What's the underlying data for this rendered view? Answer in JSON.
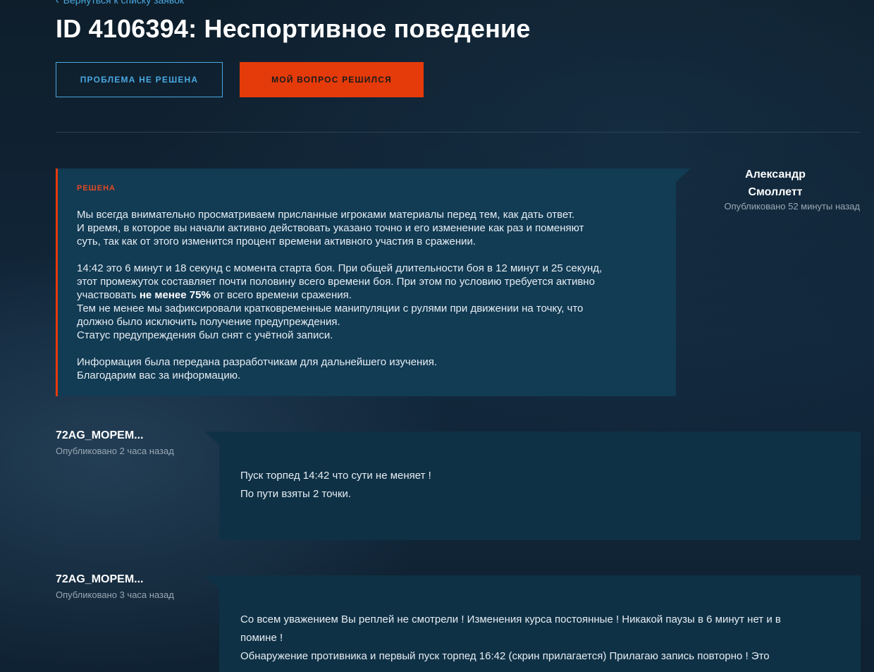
{
  "nav": {
    "back_label": "Вернуться к списку заявок"
  },
  "ticket": {
    "title": "ID 4106394: Неспортивное поведение"
  },
  "actions": {
    "not_resolved_label": "ПРОБЛЕМА НЕ РЕШЕНА",
    "resolved_label": "МОЙ ВОПРОС РЕШИЛСЯ"
  },
  "messages": [
    {
      "author": "Александр Смоллетт",
      "author_line1": "Александр",
      "author_line2": "Смоллетт",
      "published": "Опубликовано 52 минуты назад",
      "status": "РЕШЕНА",
      "lines": [
        "Мы всегда внимательно просматриваем присланные игроками материалы перед тем, как дать ответ.",
        "И время, в которое вы начали активно действовать указано точно и его изменение как раз и поменяют",
        "суть, так как от этого изменится процент времени активного участия в сражении.",
        "14:42 это 6 минут и 18 секунд с момента старта боя. При общей длительности боя в 12 минут и 25 секунд,",
        "этот промежуток составляет почти половину всего времени боя. При этом по условию требуется активно",
        "участвовать ",
        "не менее 75%",
        " от всего времени сражения.",
        "Тем не менее мы зафиксировали кратковременные манипуляции с рулями при движении на точку, что",
        "должно было исключить получение предупреждения.",
        "Статус предупреждения был снят с учётной записи.",
        "Информация была передана разработчикам для дальнейшего изучения.",
        "Благодарим вас за информацию."
      ]
    },
    {
      "author": "72AG_MOPEM...",
      "published": "Опубликовано 2 часа назад",
      "lines": [
        "Пуск торпед 14:42 что сути не меняет !",
        "По пути взяты 2 точки."
      ]
    },
    {
      "author": "72AG_MOPEM...",
      "published": "Опубликовано 3 часа назад",
      "lines": [
        "Со всем уважением Вы реплей не смотрели ! Изменения курса постоянные ! Никакой паузы в 6 минут нет и в",
        "помине !",
        "Обнаружение противника и первый пуск торпед 16:42 (скрин прилагается) Прилагаю запись повторно ! Это"
      ]
    }
  ],
  "colors": {
    "accent_blue": "#4aa8e0",
    "accent_orange": "#e53b0a",
    "status_red": "#e34a22",
    "bubble_bg": "#123b54"
  }
}
